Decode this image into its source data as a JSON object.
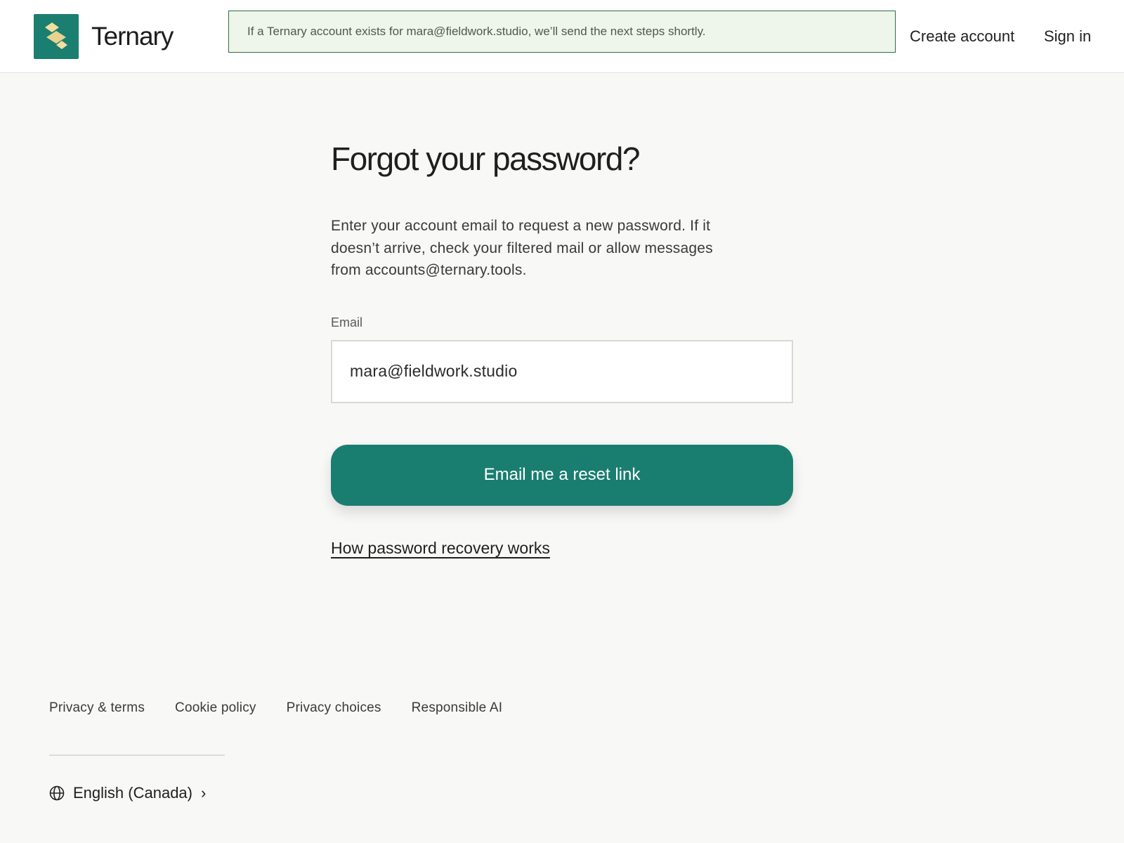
{
  "header": {
    "brand_name": "Ternary",
    "notice": "If a Ternary account exists for mara@fieldwork.studio, we’ll send the next steps shortly.",
    "nav": {
      "create_account": "Create account",
      "sign_in": "Sign in"
    }
  },
  "main": {
    "title": "Forgot your password?",
    "description": "Enter your account email to request a new password. If it doesn’t arrive, check your filtered mail or allow messages from accounts@ternary.tools.",
    "email_label": "Email",
    "email_value": "mara@fieldwork.studio",
    "submit_label": "Email me a reset link",
    "help_link": "How password recovery works"
  },
  "footer": {
    "links": [
      "Privacy & terms",
      "Cookie policy",
      "Privacy choices",
      "Responsible AI"
    ],
    "language": "English (Canada)",
    "language_chevron": "›"
  },
  "icons": {
    "logo": "ternary-logo-icon",
    "language": "globe-icon",
    "chevron": "chevron-right-icon"
  },
  "colors": {
    "brand": "#1a7e70",
    "logo_accent": "#f1dfa0",
    "notice_bg": "#eef5ea",
    "notice_border": "#2f6f43",
    "page_bg": "#f8f8f6"
  }
}
